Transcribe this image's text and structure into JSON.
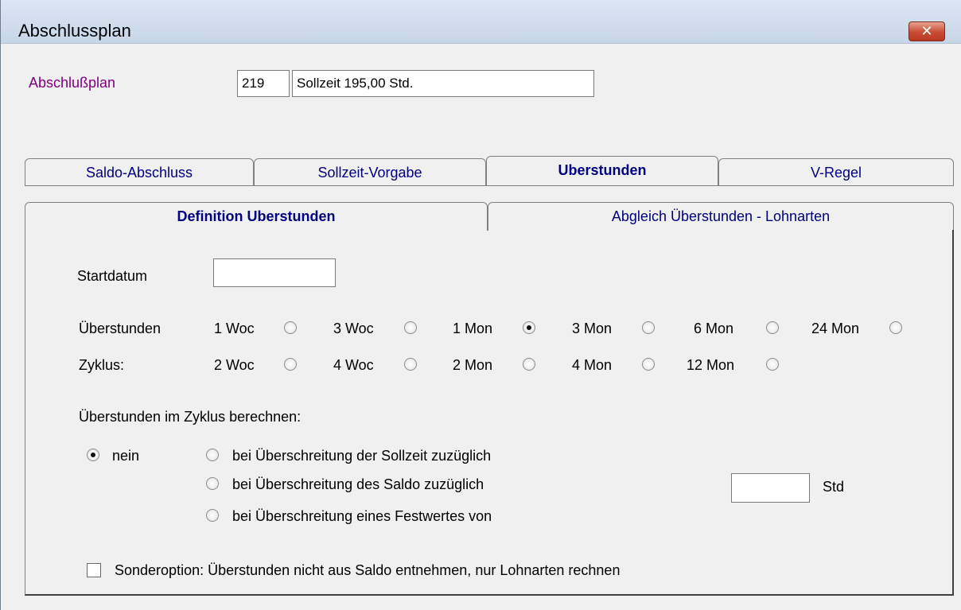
{
  "window": {
    "title": "Abschlussplan",
    "close_glyph": "✕"
  },
  "header": {
    "label": "Abschlußplan",
    "plan_number": "219",
    "plan_name": "Sollzeit 195,00 Std."
  },
  "tabs_main": [
    {
      "label": "Saldo-Abschluss"
    },
    {
      "label": "Sollzeit-Vorgabe"
    },
    {
      "label": "Uberstunden",
      "active": true
    },
    {
      "label": "V-Regel"
    }
  ],
  "tabs_sub": [
    {
      "label": "Definition Uberstunden",
      "active": true
    },
    {
      "label": "Abgleich  Überstunden - Lohnarten"
    }
  ],
  "form": {
    "startdatum_label": "Startdatum",
    "startdatum_value": "",
    "zyklus_label_1": "Überstunden",
    "zyklus_label_2": "Zyklus:",
    "zyklus_options": [
      {
        "label": "1 Woc",
        "selected": false
      },
      {
        "label": "3 Woc",
        "selected": false
      },
      {
        "label": "1 Mon",
        "selected": true
      },
      {
        "label": "3 Mon",
        "selected": false
      },
      {
        "label": "6 Mon",
        "selected": false
      },
      {
        "label": "24 Mon",
        "selected": false
      },
      {
        "label": "2 Woc",
        "selected": false
      },
      {
        "label": "4 Woc",
        "selected": false
      },
      {
        "label": "2 Mon",
        "selected": false
      },
      {
        "label": "4 Mon",
        "selected": false
      },
      {
        "label": "12 Mon",
        "selected": false
      }
    ],
    "berechnen_label": "Überstunden im Zyklus berechnen:",
    "berechnen_options": [
      {
        "label": "nein",
        "selected": true
      },
      {
        "label": "bei Überschreitung der Sollzeit zuzüglich",
        "selected": false
      },
      {
        "label": "bei Überschreitung des Saldo  zuzüglich",
        "selected": false
      },
      {
        "label": "bei Überschreitung eines Festwertes von",
        "selected": false
      }
    ],
    "std_value": "",
    "std_label": "Std",
    "sonderoption_label": "Sonderoption: Überstunden nicht aus Saldo entnehmen, nur Lohnarten rechnen",
    "sonderoption_checked": false
  }
}
